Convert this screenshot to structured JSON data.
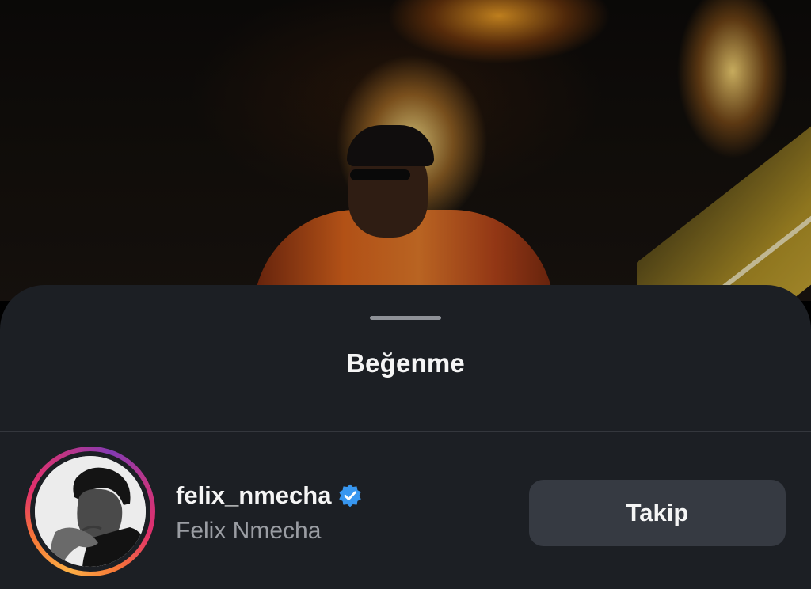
{
  "sheet": {
    "title": "Beğenme"
  },
  "user": {
    "username": "felix_nmecha",
    "full_name": "Felix Nmecha",
    "verified": true,
    "verified_icon": "verified-badge-icon",
    "story_ring": true,
    "follow_label": "Takip"
  },
  "colors": {
    "sheet_background": "#1c1f24",
    "follow_button": "#363a42",
    "verified_badge": "#3897f0",
    "secondary_text": "#9a9da3"
  }
}
